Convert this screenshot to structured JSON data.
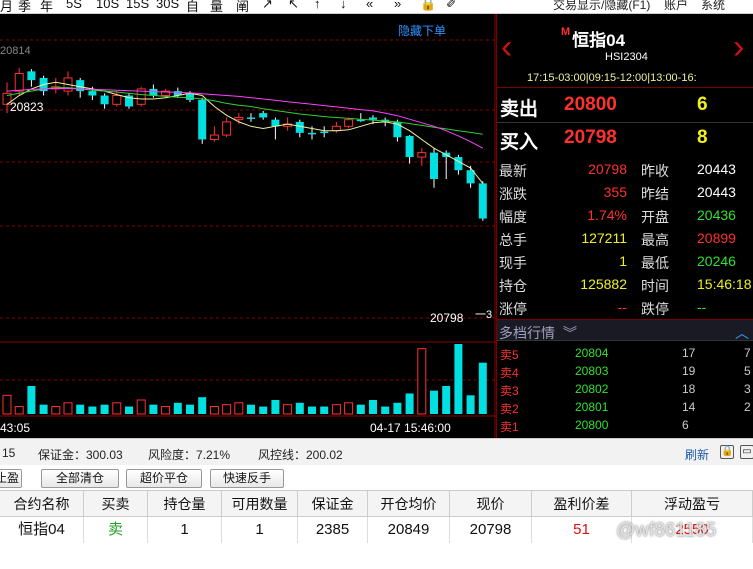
{
  "toolbar": {
    "left_tools": [
      "月",
      "季",
      "年",
      "5S",
      "10S",
      "15S",
      "30S",
      "自",
      "量",
      "阐",
      "↗",
      "↖",
      "↑",
      "↓",
      "«",
      "»",
      "🔒",
      "✐"
    ],
    "menus": [
      "交易显示/隐藏(F1)",
      "账户",
      "系统"
    ]
  },
  "chart": {
    "hide_order_link": "隐藏下单",
    "ref_price": "20814",
    "high_label": "20823",
    "last_label": "20798",
    "last_tick": "一3",
    "time_left": "43:05",
    "time_right": "04-17 15:46:00"
  },
  "chart_data": {
    "type": "candlestick",
    "price_range": [
      20240,
      20900
    ],
    "candles": [
      {
        "o": 20740,
        "c": 20765,
        "h": 20790,
        "l": 20720
      },
      {
        "o": 20770,
        "c": 20810,
        "h": 20823,
        "l": 20760
      },
      {
        "o": 20815,
        "c": 20795,
        "h": 20820,
        "l": 20780
      },
      {
        "o": 20800,
        "c": 20770,
        "h": 20805,
        "l": 20760
      },
      {
        "o": 20775,
        "c": 20780,
        "h": 20800,
        "l": 20765
      },
      {
        "o": 20770,
        "c": 20800,
        "h": 20815,
        "l": 20760
      },
      {
        "o": 20795,
        "c": 20770,
        "h": 20800,
        "l": 20755
      },
      {
        "o": 20770,
        "c": 20760,
        "h": 20780,
        "l": 20750
      },
      {
        "o": 20760,
        "c": 20740,
        "h": 20765,
        "l": 20730
      },
      {
        "o": 20740,
        "c": 20760,
        "h": 20770,
        "l": 20735
      },
      {
        "o": 20760,
        "c": 20735,
        "h": 20765,
        "l": 20730
      },
      {
        "o": 20740,
        "c": 20775,
        "h": 20780,
        "l": 20735
      },
      {
        "o": 20775,
        "c": 20760,
        "h": 20785,
        "l": 20755
      },
      {
        "o": 20760,
        "c": 20770,
        "h": 20775,
        "l": 20755
      },
      {
        "o": 20770,
        "c": 20760,
        "h": 20778,
        "l": 20755
      },
      {
        "o": 20765,
        "c": 20750,
        "h": 20770,
        "l": 20745
      },
      {
        "o": 20750,
        "c": 20660,
        "h": 20755,
        "l": 20650
      },
      {
        "o": 20660,
        "c": 20670,
        "h": 20690,
        "l": 20655
      },
      {
        "o": 20670,
        "c": 20700,
        "h": 20710,
        "l": 20665
      },
      {
        "o": 20705,
        "c": 20710,
        "h": 20720,
        "l": 20695
      },
      {
        "o": 20710,
        "c": 20710,
        "h": 20720,
        "l": 20700
      },
      {
        "o": 20720,
        "c": 20710,
        "h": 20725,
        "l": 20705
      },
      {
        "o": 20705,
        "c": 20690,
        "h": 20710,
        "l": 20660
      },
      {
        "o": 20690,
        "c": 20695,
        "h": 20710,
        "l": 20680
      },
      {
        "o": 20700,
        "c": 20675,
        "h": 20705,
        "l": 20665
      },
      {
        "o": 20675,
        "c": 20675,
        "h": 20690,
        "l": 20660
      },
      {
        "o": 20678,
        "c": 20678,
        "h": 20690,
        "l": 20665
      },
      {
        "o": 20680,
        "c": 20690,
        "h": 20700,
        "l": 20675
      },
      {
        "o": 20690,
        "c": 20705,
        "h": 20710,
        "l": 20685
      },
      {
        "o": 20705,
        "c": 20705,
        "h": 20720,
        "l": 20700
      },
      {
        "o": 20710,
        "c": 20705,
        "h": 20715,
        "l": 20695
      },
      {
        "o": 20705,
        "c": 20700,
        "h": 20710,
        "l": 20690
      },
      {
        "o": 20700,
        "c": 20665,
        "h": 20705,
        "l": 20655
      },
      {
        "o": 20668,
        "c": 20620,
        "h": 20670,
        "l": 20605
      },
      {
        "o": 20620,
        "c": 20630,
        "h": 20640,
        "l": 20600
      },
      {
        "o": 20630,
        "c": 20570,
        "h": 20640,
        "l": 20550
      },
      {
        "o": 20630,
        "c": 20620,
        "h": 20635,
        "l": 20570
      },
      {
        "o": 20620,
        "c": 20590,
        "h": 20625,
        "l": 20580
      },
      {
        "o": 20590,
        "c": 20560,
        "h": 20600,
        "l": 20550
      },
      {
        "o": 20560,
        "c": 20480,
        "h": 20565,
        "l": 20475
      }
    ],
    "ma_lines": [
      {
        "name": "MA5",
        "color": "#f0f0a0",
        "values": [
          20740,
          20760,
          20775,
          20785,
          20790,
          20785,
          20780,
          20775,
          20770,
          20762,
          20755,
          20752,
          20752,
          20755,
          20760,
          20765,
          20760,
          20735,
          20715,
          20700,
          20690,
          20685,
          20690,
          20695,
          20690,
          20685,
          20680,
          20680,
          20682,
          20690,
          20698,
          20700,
          20695,
          20680,
          20660,
          20640,
          20625,
          20610,
          20595,
          20560
        ]
      },
      {
        "name": "MA10",
        "color": "#30d030",
        "values": [
          20760,
          20765,
          20770,
          20775,
          20778,
          20778,
          20775,
          20772,
          20770,
          20768,
          20765,
          20762,
          20760,
          20758,
          20756,
          20755,
          20752,
          20748,
          20742,
          20738,
          20735,
          20730,
          20726,
          20722,
          20718,
          20715,
          20712,
          20710,
          20708,
          20706,
          20704,
          20702,
          20700,
          20696,
          20692,
          20688,
          20684,
          20680,
          20676,
          20672
        ]
      },
      {
        "name": "MA20",
        "color": "#ff40ff",
        "values": [
          20770,
          20772,
          20774,
          20775,
          20776,
          20776,
          20775,
          20774,
          20773,
          20772,
          20771,
          20770,
          20769,
          20768,
          20767,
          20766,
          20764,
          20762,
          20760,
          20758,
          20755,
          20752,
          20749,
          20746,
          20743,
          20740,
          20737,
          20734,
          20731,
          20728,
          20725,
          20720,
          20714,
          20706,
          20698,
          20690,
          20680,
          20668,
          20655,
          20640
        ]
      }
    ],
    "volumes": [
      20,
      8,
      30,
      10,
      8,
      12,
      10,
      8,
      10,
      12,
      8,
      15,
      10,
      8,
      12,
      10,
      18,
      8,
      10,
      12,
      10,
      8,
      15,
      10,
      12,
      8,
      8,
      10,
      12,
      10,
      15,
      8,
      12,
      22,
      70,
      25,
      30,
      75,
      20,
      55
    ]
  },
  "quote": {
    "contract_name": "恒指04",
    "mark": "M",
    "contract_code": "HSI2304",
    "session": "17:15-03:00|09:15-12:00|13:00-16:",
    "ask_label": "卖出",
    "ask_price": "20800",
    "ask_vol": "6",
    "bid_label": "买入",
    "bid_price": "20798",
    "bid_vol": "8",
    "stats": [
      {
        "k1": "最新",
        "v1": "20798",
        "c1": "#ff3030",
        "k2": "昨收",
        "v2": "20443",
        "c2": "#ffffff"
      },
      {
        "k1": "涨跌",
        "v1": "355",
        "c1": "#ff3030",
        "k2": "昨结",
        "v2": "20443",
        "c2": "#ffffff"
      },
      {
        "k1": "幅度",
        "v1": "1.74%",
        "c1": "#ff3030",
        "k2": "开盘",
        "v2": "20436",
        "c2": "#30e030"
      },
      {
        "k1": "总手",
        "v1": "127211",
        "c1": "#f0f020",
        "k2": "最高",
        "v2": "20899",
        "c2": "#ff3030"
      },
      {
        "k1": "现手",
        "v1": "1",
        "c1": "#f0f020",
        "k2": "最低",
        "v2": "20246",
        "c2": "#30e030"
      },
      {
        "k1": "持仓",
        "v1": "125882",
        "c1": "#f0f020",
        "k2": "时间",
        "v2": "15:46:18",
        "c2": "#f0f020"
      },
      {
        "k1": "涨停",
        "v1": "--",
        "c1": "#ff3030",
        "k2": "跌停",
        "v2": "--",
        "c2": "#30e030"
      }
    ],
    "depth_title": "多档行情",
    "depth": [
      {
        "l": "卖5",
        "p": "20804",
        "v": "17",
        "v2": "7"
      },
      {
        "l": "卖4",
        "p": "20803",
        "v": "19",
        "v2": "5"
      },
      {
        "l": "卖3",
        "p": "20802",
        "v": "18",
        "v2": "3"
      },
      {
        "l": "卖2",
        "p": "20801",
        "v": "14",
        "v2": "2"
      },
      {
        "l": "卖1",
        "p": "20800",
        "v": "6",
        "v2": ""
      }
    ]
  },
  "status": {
    "prefix": "15",
    "margin_label": "保证金：300.03",
    "risk_label": "风险度：7.21%",
    "control_label": "风控线：200.02",
    "refresh": "刷新"
  },
  "actions": {
    "partial": "止盈",
    "close_all": "全部清仓",
    "super_close": "超价平仓",
    "reverse": "快速反手"
  },
  "positions": {
    "headers": [
      "合约名称",
      "买卖",
      "持仓量",
      "可用数量",
      "保证金",
      "开仓均价",
      "现价",
      "盈利价差",
      "浮动盈亏"
    ],
    "row": [
      "恒指04",
      "卖",
      "1",
      "1",
      "2385",
      "20849",
      "20798",
      "51",
      "2550"
    ]
  },
  "watermark": "@wf861185"
}
